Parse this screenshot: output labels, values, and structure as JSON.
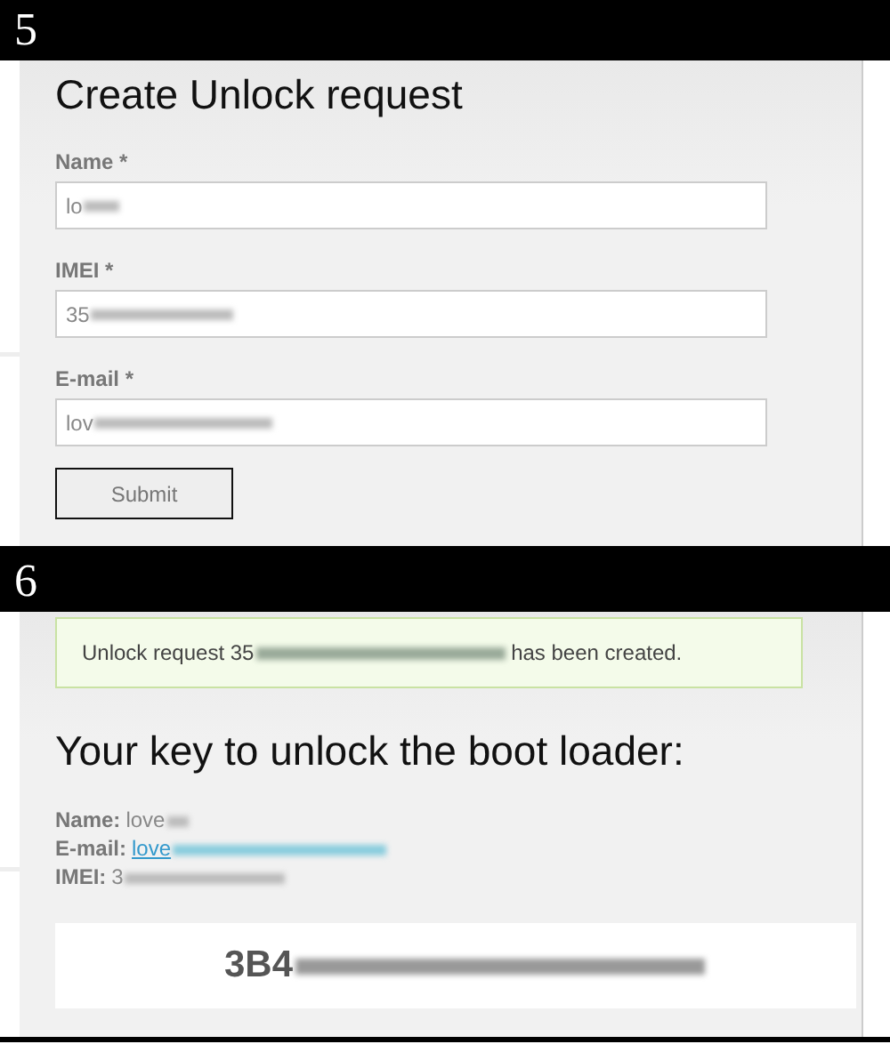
{
  "steps": [
    {
      "number": "5",
      "kind": "form",
      "title": "Create Unlock request",
      "fields": [
        {
          "label": "Name *",
          "value": "lo"
        },
        {
          "label": "IMEI *",
          "value": "35"
        },
        {
          "label": "E-mail *",
          "value": "lov"
        }
      ],
      "submit": "Submit"
    },
    {
      "number": "6",
      "kind": "result",
      "notice": {
        "before": "Unlock request 35",
        "after": "has been created."
      },
      "title": "Your key to unlock the boot loader:",
      "details": [
        {
          "label": "Name:",
          "value": "love",
          "kind": "text"
        },
        {
          "label": "E-mail:",
          "value": "love",
          "kind": "link"
        },
        {
          "label": "IMEI:",
          "value": "3",
          "kind": "text"
        }
      ],
      "key": "3B4"
    }
  ]
}
